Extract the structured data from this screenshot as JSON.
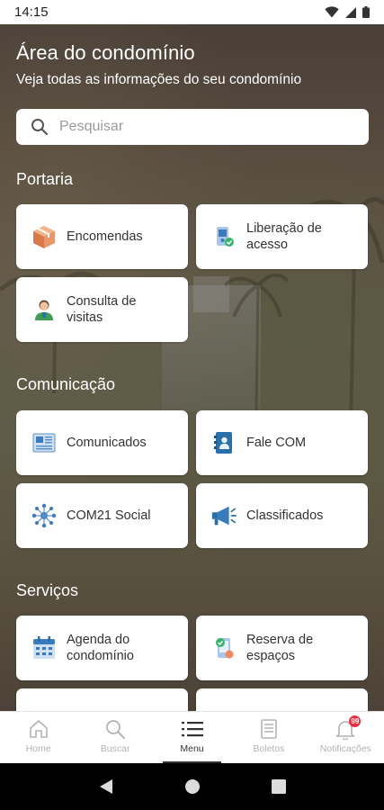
{
  "status_bar": {
    "time": "14:15"
  },
  "header": {
    "title": "Área do condomínio",
    "subtitle": "Veja todas as informações do seu condomínio"
  },
  "search": {
    "placeholder": "Pesquisar",
    "icon": "search-icon"
  },
  "sections": {
    "portaria": {
      "title": "Portaria",
      "items": [
        {
          "label": "Encomendas",
          "icon": "package-icon"
        },
        {
          "label": "Liberação de\nacesso",
          "icon": "access-release-icon"
        },
        {
          "label": "Consulta de\nvisitas",
          "icon": "visitor-icon"
        }
      ]
    },
    "comunicacao": {
      "title": "Comunicação",
      "items": [
        {
          "label": "Comunicados",
          "icon": "newspaper-icon"
        },
        {
          "label": "Fale COM",
          "icon": "contact-book-icon"
        },
        {
          "label": "COM21 Social",
          "icon": "social-network-icon"
        },
        {
          "label": "Classificados",
          "icon": "megaphone-icon"
        }
      ]
    },
    "servicos": {
      "title": "Serviços",
      "items": [
        {
          "label": "Agenda do\ncondomínio",
          "icon": "calendar-icon"
        },
        {
          "label": "Reserva de\nespaços",
          "icon": "space-reservation-icon"
        }
      ]
    }
  },
  "bottom_nav": {
    "items": [
      {
        "label": "Home",
        "icon": "home-icon"
      },
      {
        "label": "Buscar",
        "icon": "search-icon"
      },
      {
        "label": "Menu",
        "icon": "menu-icon",
        "active": true
      },
      {
        "label": "Boletos",
        "icon": "invoice-icon"
      },
      {
        "label": "Notificações",
        "icon": "bell-icon",
        "badge": "99"
      }
    ]
  },
  "colors": {
    "accent_orange": "#f08a5d",
    "accent_blue": "#3a7bbf",
    "badge_red": "#e5303d"
  }
}
